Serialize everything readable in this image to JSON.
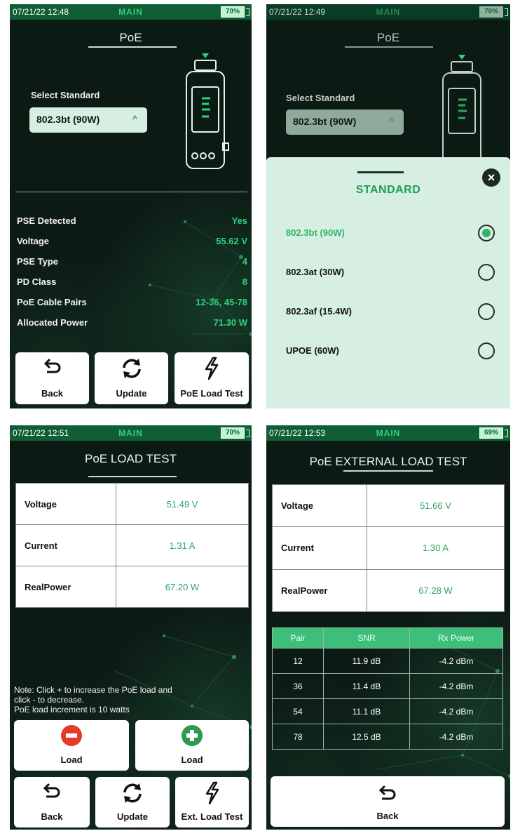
{
  "colors": {
    "accent": "#2fd27c",
    "brand": "#0f5e36",
    "background": "#0c1a14",
    "sheet": "#d7efe2"
  },
  "screens": [
    {
      "status": {
        "time": "07/21/22 12:48",
        "mode": "MAIN",
        "battery": "70%"
      },
      "title": "PoE",
      "select_label": "Select Standard",
      "select_value": "802.3bt (90W)",
      "rows": [
        {
          "label": "PSE Detected",
          "value": "Yes"
        },
        {
          "label": "Voltage",
          "value": "55.62 V"
        },
        {
          "label": "PSE Type",
          "value": "4"
        },
        {
          "label": "PD Class",
          "value": "8"
        },
        {
          "label": "PoE Cable Pairs",
          "value": "12-36, 45-78"
        },
        {
          "label": "Allocated Power",
          "value": "71.30 W"
        }
      ],
      "buttons": [
        {
          "label": "Back",
          "icon": "back-arrow-icon"
        },
        {
          "label": "Update",
          "icon": "refresh-icon"
        },
        {
          "label": "PoE Load Test",
          "icon": "lightning-icon"
        }
      ]
    },
    {
      "status": {
        "time": "07/21/22 12:49",
        "mode": "MAIN",
        "battery": "70%"
      },
      "title": "PoE",
      "select_label": "Select Standard",
      "select_value": "802.3bt (90W)",
      "sheet": {
        "title": "STANDARD",
        "options": [
          {
            "label": "802.3bt (90W)",
            "selected": true
          },
          {
            "label": "802.3at (30W)",
            "selected": false
          },
          {
            "label": "802.3af (15.4W)",
            "selected": false
          },
          {
            "label": "UPOE (60W)",
            "selected": false
          }
        ]
      }
    },
    {
      "status": {
        "time": "07/21/22 12:51",
        "mode": "MAIN",
        "battery": "70%"
      },
      "title": "PoE LOAD TEST",
      "rows": [
        {
          "label": "Voltage",
          "value": "51.49 V"
        },
        {
          "label": "Current",
          "value": "1.31 A"
        },
        {
          "label": "RealPower",
          "value": "67.20 W"
        }
      ],
      "note": [
        "Note: Click + to increase the PoE load and",
        "click - to decrease.",
        "PoE load increment is 10 watts"
      ],
      "load_buttons": [
        {
          "label": "Load",
          "icon": "minus-circle-icon"
        },
        {
          "label": "Load",
          "icon": "plus-circle-icon"
        }
      ],
      "buttons": [
        {
          "label": "Back",
          "icon": "back-arrow-icon"
        },
        {
          "label": "Update",
          "icon": "refresh-icon"
        },
        {
          "label": "Ext. Load Test",
          "icon": "lightning-icon"
        }
      ]
    },
    {
      "status": {
        "time": "07/21/22 12:53",
        "mode": "MAIN",
        "battery": "69%"
      },
      "title": "PoE EXTERNAL LOAD TEST",
      "rows": [
        {
          "label": "Voltage",
          "value": "51.66 V"
        },
        {
          "label": "Current",
          "value": "1.30 A"
        },
        {
          "label": "RealPower",
          "value": "67.28 W"
        }
      ],
      "pair_table": {
        "headers": [
          "Pair",
          "SNR",
          "Rx Power"
        ],
        "rows": [
          [
            "12",
            "11.9 dB",
            "-4.2 dBm"
          ],
          [
            "36",
            "11.4 dB",
            "-4.2 dBm"
          ],
          [
            "54",
            "11.1 dB",
            "-4.2 dBm"
          ],
          [
            "78",
            "12.5 dB",
            "-4.2 dBm"
          ]
        ]
      },
      "buttons": [
        {
          "label": "Back",
          "icon": "back-arrow-icon"
        }
      ]
    }
  ]
}
